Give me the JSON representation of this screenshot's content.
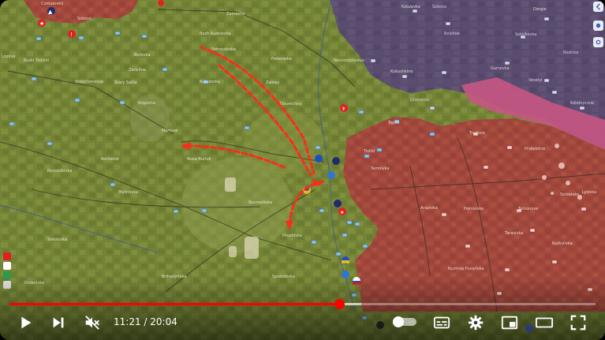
{
  "player": {
    "current_time": "11:21",
    "duration": "20:04",
    "time_separator": " / ",
    "progress_fraction": 0.5627,
    "loaded_fraction": 0.6,
    "accent_color": "#ff0000"
  },
  "controls": {
    "play_icon": "play-icon",
    "next_icon": "next-icon",
    "mute_icon": "volume-muted-icon",
    "autoplay_icon": "autoplay-toggle-icon",
    "subtitles_icon": "subtitles-icon",
    "settings_icon": "gear-icon",
    "miniplayer_icon": "miniplayer-icon",
    "theater_icon": "theater-mode-icon",
    "fullscreen_icon": "fullscreen-icon"
  },
  "map": {
    "colors": {
      "controlled_green": "#7a8a3a",
      "occupied_red": "#a8483a",
      "contested_pink": "#c0527a",
      "russia_purple": "#5e4f72",
      "attack_arrow": "#ff2a1a"
    },
    "places": [
      "Comuerekli",
      "Zamashe",
      "Kobzevka",
      "Dargie",
      "Sokovo",
      "Lozova",
      "Burovka",
      "Bazh Kudelevka",
      "Petrovdovka",
      "Federovka",
      "Novozolotarevo",
      "Mamay",
      "Zamay",
      "Kukushkino",
      "Samoelek",
      "Gurnaya",
      "Vinnitsyno",
      "Ruski Tishkin",
      "Shevchenkove",
      "Stary Saltiv",
      "Zarichne",
      "Kupyansk",
      "Kropivna",
      "Kutuzovka",
      "Dvurechna",
      "Topoli",
      "Peschanoe",
      "Tishki",
      "Pechenihi",
      "Nova Burluk",
      "Martove",
      "Kochetok",
      "Chuhuiv",
      "Tamnivka",
      "Arapivka",
      "Pokrovske",
      "Tymonove",
      "Lysivka",
      "Zarichne",
      "Sofiivka",
      "Sokolovka",
      "Novosilkivka",
      "Malinovka",
      "Novoselivka",
      "Krasna",
      "Horobivka",
      "Bryanka",
      "Kuchkovka",
      "Zybyne",
      "Lyptsi",
      "Starytsia",
      "Shestakove",
      "Oleksiivka",
      "Chervona Khvylia",
      "Spodobivka",
      "Vilkhuvatka",
      "Hatyshche",
      "Nesterne",
      "Pryvillia",
      "Vovchansk",
      "Budarky",
      "Mylove",
      "Ohirtseve",
      "Ternova",
      "Zelene",
      "Bilyi Kolodiaz",
      "Ryzhiv",
      "Vasylivka",
      "Danylivka",
      "Zakharivka"
    ]
  }
}
